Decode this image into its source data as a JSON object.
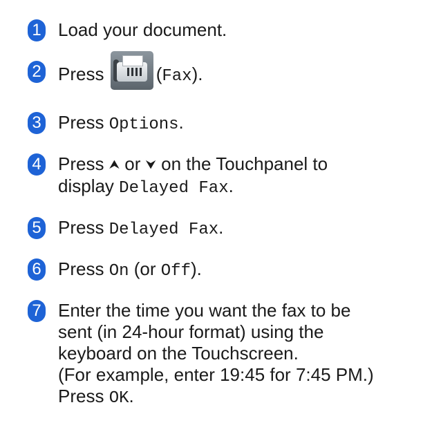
{
  "steps": [
    {
      "number": "1",
      "text": "Load your document."
    },
    {
      "number": "2",
      "prefix": "Press",
      "icon_name": "fax-icon",
      "suffix_open": "(",
      "code": "Fax",
      "suffix_close": ")."
    },
    {
      "number": "3",
      "prefix": "Press",
      "code": "Options",
      "suffix": "."
    },
    {
      "number": "4",
      "prefix": "Press",
      "up_icon": "chevron-up-icon",
      "or": "or",
      "down_icon": "chevron-down-icon",
      "mid": "on the Touchpanel to",
      "line2_prefix": "display",
      "code": "Delayed Fax",
      "suffix": "."
    },
    {
      "number": "5",
      "prefix": "Press",
      "code": "Delayed Fax",
      "suffix": "."
    },
    {
      "number": "6",
      "prefix": "Press",
      "code": "On",
      "mid_open": "(or",
      "code2": "Off",
      "suffix": ")."
    },
    {
      "number": "7",
      "lines": [
        "Enter the time you want the fax to be",
        "sent (in 24-hour format) using the",
        "keyboard on the Touchscreen.",
        "(For example, enter 19:45 for 7:45 PM.)"
      ],
      "last_prefix": "Press",
      "code": "OK",
      "suffix": "."
    }
  ],
  "colors": {
    "badge": "#1e63d6",
    "text": "#1a1a1a"
  }
}
